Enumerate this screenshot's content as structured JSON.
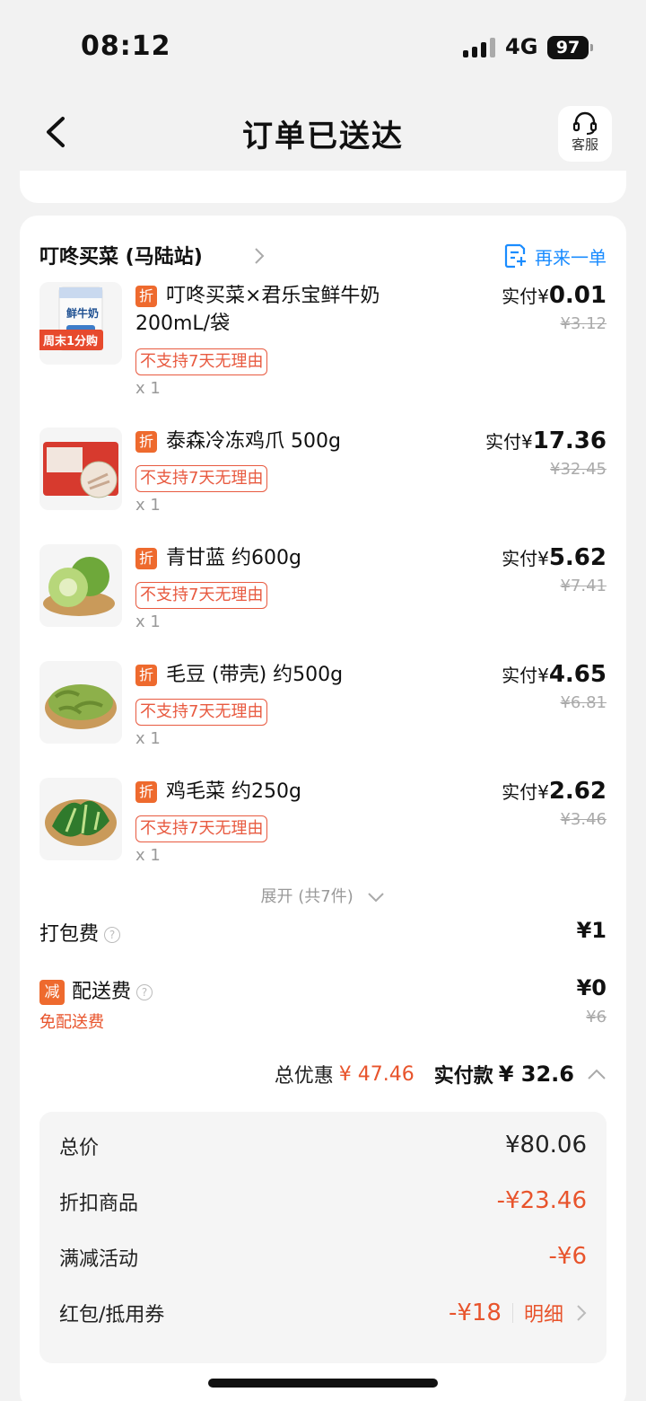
{
  "status_bar": {
    "time": "08:12",
    "network": "4G",
    "battery": "97"
  },
  "nav": {
    "title": "订单已送达",
    "service_label": "客服"
  },
  "store": {
    "name": "叮咚买菜 (马陆站)",
    "reorder_label": "再来一单"
  },
  "items": [
    {
      "name": "叮咚买菜×君乐宝鲜牛奶200mL/袋",
      "paid_label": "实付¥",
      "paid_value": "0.01",
      "original": "¥3.12",
      "policy": "不支持7天无理由",
      "qty": "x 1",
      "badge": "折",
      "promo": "周末1分购",
      "pack_label": "鲜牛奶"
    },
    {
      "name": "泰森冷冻鸡爪 500g",
      "paid_label": "实付¥",
      "paid_value": "17.36",
      "original": "¥32.45",
      "policy": "不支持7天无理由",
      "qty": "x 1",
      "badge": "折"
    },
    {
      "name": "青甘蓝 约600g",
      "paid_label": "实付¥",
      "paid_value": "5.62",
      "original": "¥7.41",
      "policy": "不支持7天无理由",
      "qty": "x 1",
      "badge": "折"
    },
    {
      "name": "毛豆 (带壳) 约500g",
      "paid_label": "实付¥",
      "paid_value": "4.65",
      "original": "¥6.81",
      "policy": "不支持7天无理由",
      "qty": "x 1",
      "badge": "折"
    },
    {
      "name": "鸡毛菜 约250g",
      "paid_label": "实付¥",
      "paid_value": "2.62",
      "original": "¥3.46",
      "policy": "不支持7天无理由",
      "qty": "x 1",
      "badge": "折"
    }
  ],
  "expand_label": "展开 (共7件)",
  "packing_fee": {
    "label": "打包费",
    "value": "¥1"
  },
  "delivery_fee": {
    "badge": "减",
    "label": "配送费",
    "value": "¥0",
    "original": "¥6",
    "note": "免配送费"
  },
  "totals": {
    "discount_label": "总优惠",
    "discount_value": "¥ 47.46",
    "paid_label": "实付款",
    "paid_value": "¥ 32.6"
  },
  "summary": {
    "total_label": "总价",
    "total_value": "¥80.06",
    "discount_goods_label": "折扣商品",
    "discount_goods_value": "-¥23.46",
    "full_reduction_label": "满减活动",
    "full_reduction_value": "-¥6",
    "coupon_label": "红包/抵用券",
    "coupon_value": "-¥18",
    "detail_label": "明细"
  },
  "colors": {
    "accent_orange": "#ee6a2e",
    "price_red": "#e8542c",
    "link_blue": "#1a8cff"
  }
}
